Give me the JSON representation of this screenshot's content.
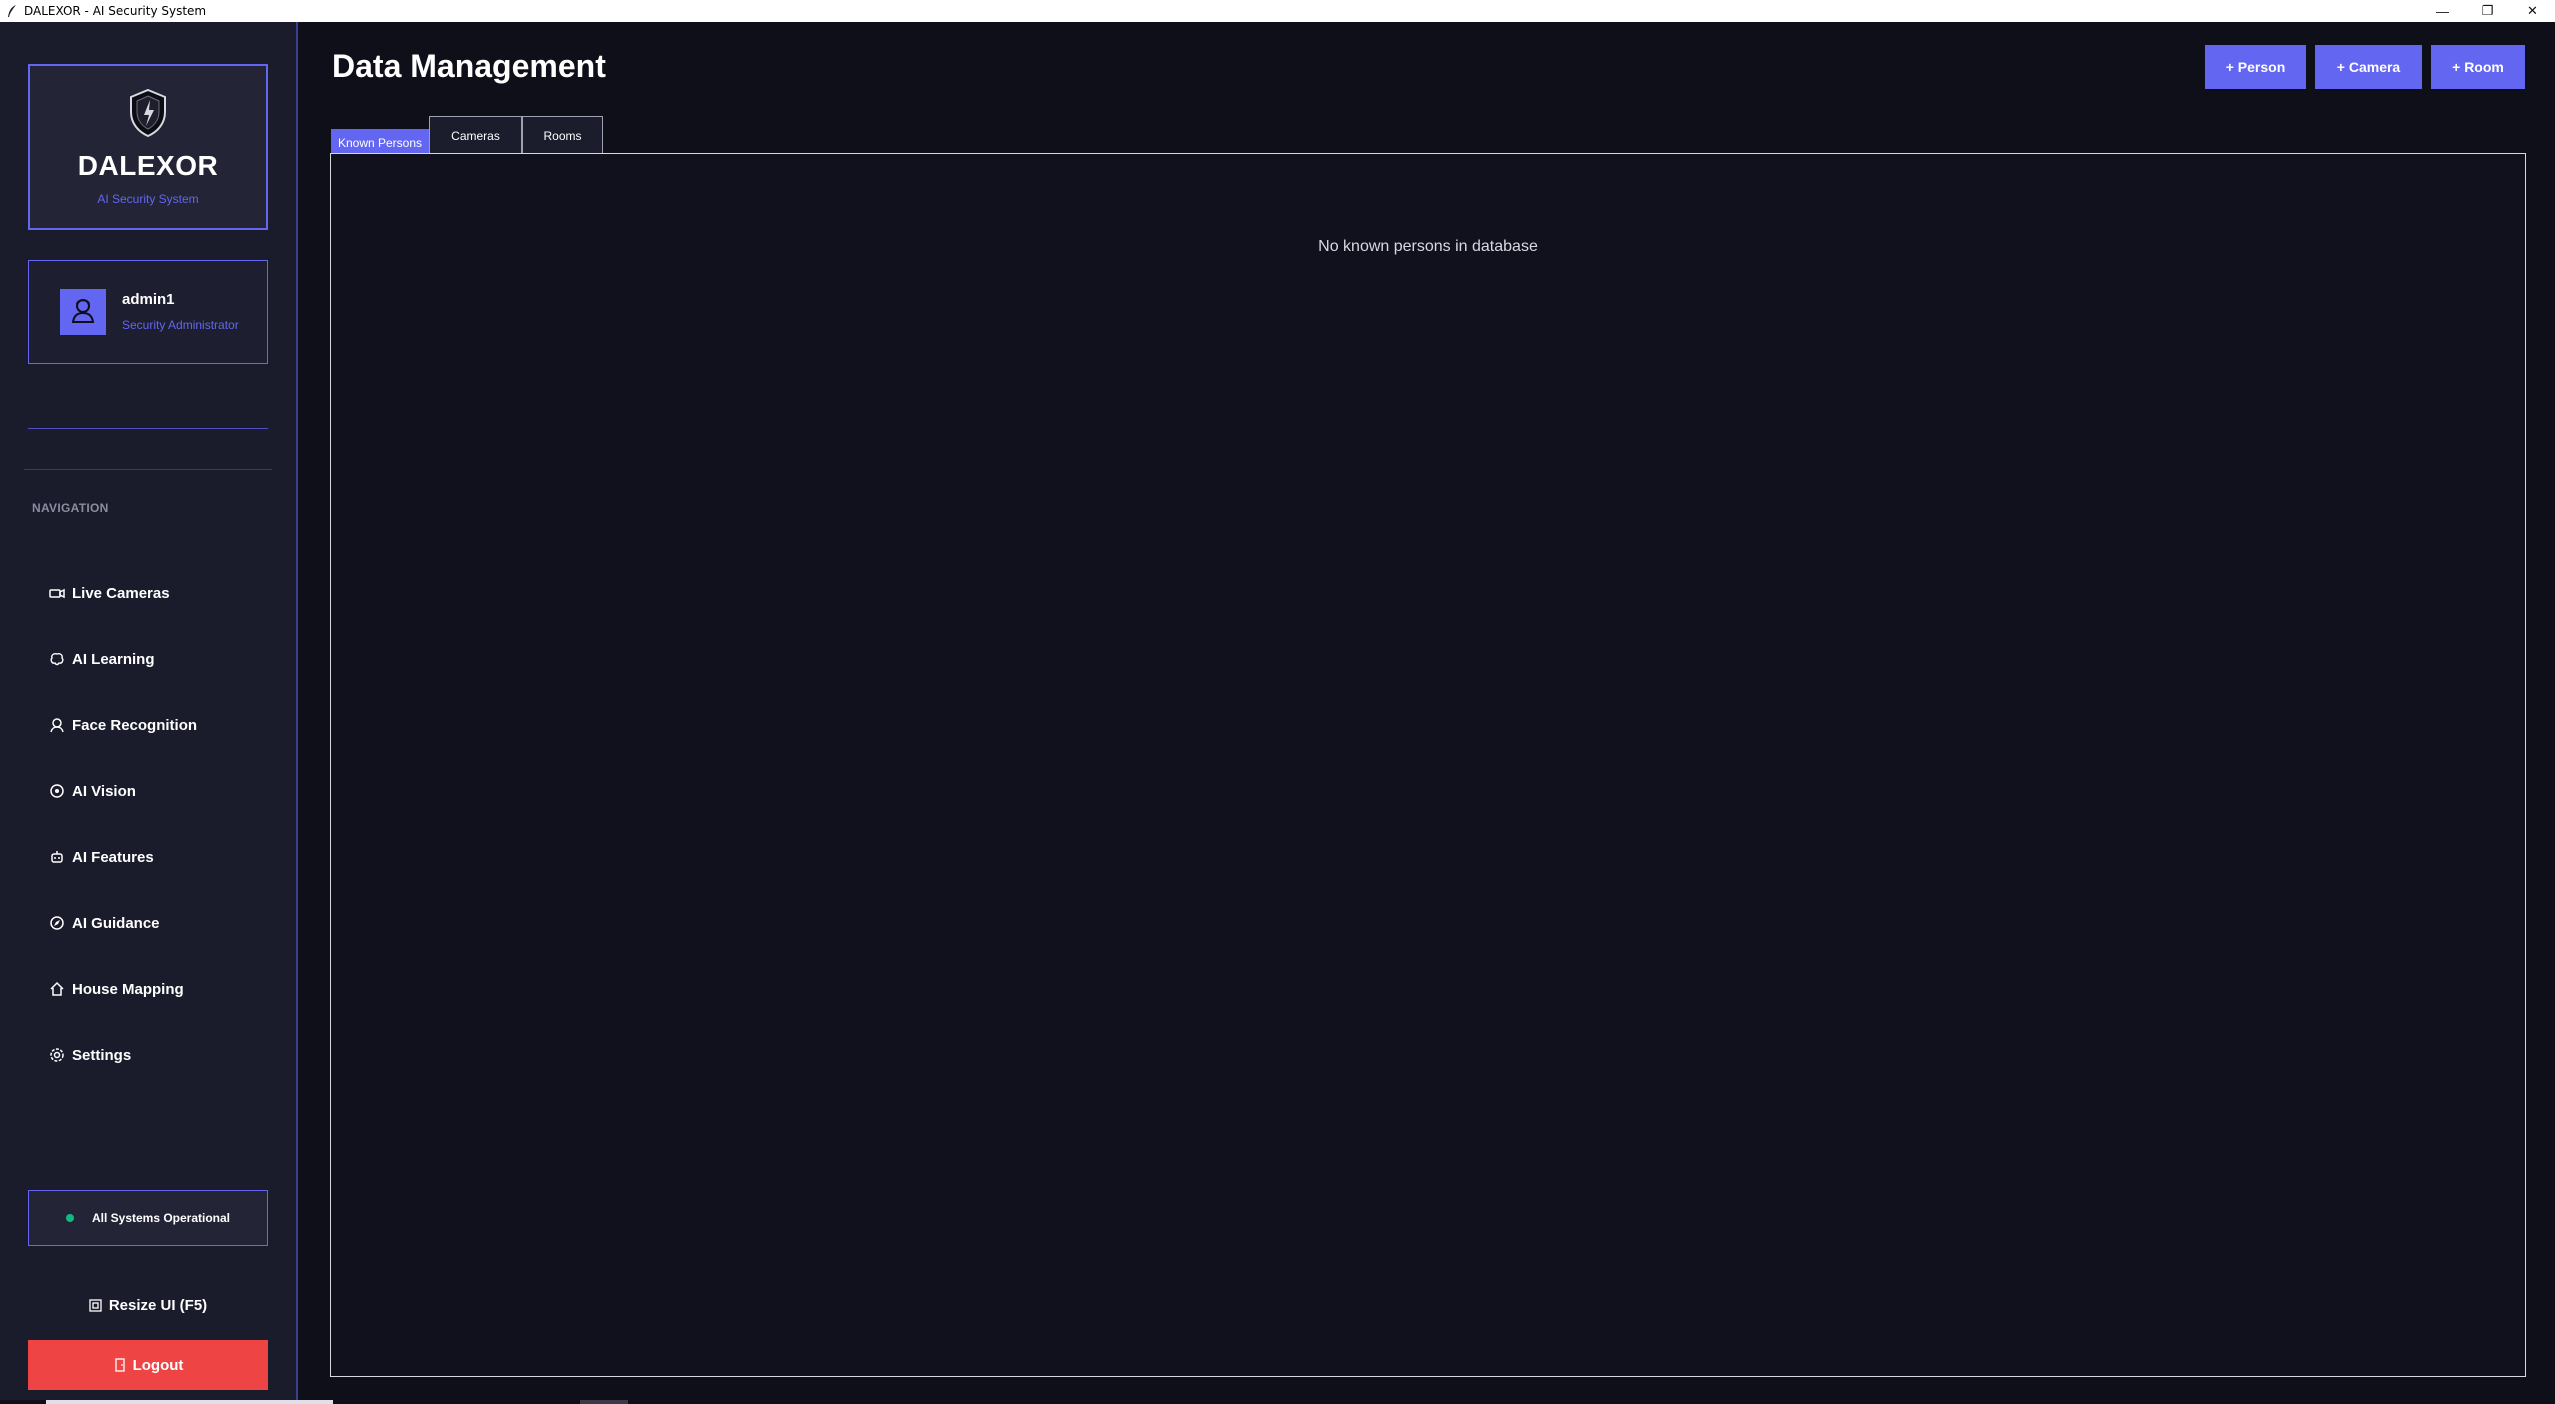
{
  "window": {
    "title": "DALEXOR - AI Security System",
    "controls": {
      "minimize": "—",
      "restore": "❐",
      "close": "✕"
    }
  },
  "sidebar": {
    "brand": {
      "name": "DALEXOR",
      "subtitle": "AI Security System",
      "icon": "shield-icon"
    },
    "user": {
      "name": "admin1",
      "role": "Security Administrator",
      "icon": "user-icon"
    },
    "nav_label": "NAVIGATION",
    "items": [
      {
        "label": "Live Cameras",
        "icon": "camera-icon"
      },
      {
        "label": "AI Learning",
        "icon": "brain-icon"
      },
      {
        "label": "Face Recognition",
        "icon": "face-icon"
      },
      {
        "label": "AI Vision",
        "icon": "eye-icon"
      },
      {
        "label": "AI Features",
        "icon": "robot-icon"
      },
      {
        "label": "AI Guidance",
        "icon": "compass-icon"
      },
      {
        "label": "House Mapping",
        "icon": "house-icon"
      },
      {
        "label": "Settings",
        "icon": "gear-icon"
      }
    ],
    "status": "All Systems Operational",
    "resize_label": "Resize UI (F5)",
    "logout_label": "Logout"
  },
  "main": {
    "title": "Data Management",
    "actions": {
      "person": "+ Person",
      "camera": "+ Camera",
      "room": "+ Room"
    },
    "tabs": [
      "Known Persons",
      "Cameras",
      "Rooms"
    ],
    "active_tab": "Known Persons",
    "empty_message": "No known persons in database"
  },
  "colors": {
    "accent": "#6366f1",
    "background": "#0f0f1a",
    "sidebar": "#1a1b2b",
    "status_ok": "#10b981",
    "danger": "#ef4444"
  }
}
